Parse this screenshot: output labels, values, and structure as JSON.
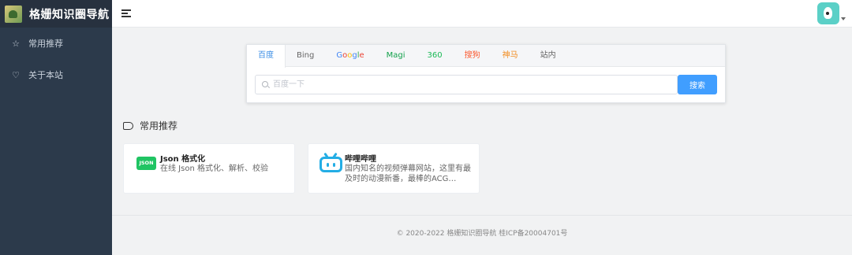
{
  "brand": {
    "title": "格姗知识圈导航"
  },
  "sidebar": {
    "items": [
      {
        "label": "常用推荐",
        "icon": "star-icon"
      },
      {
        "label": "关于本站",
        "icon": "heart-icon"
      }
    ]
  },
  "search": {
    "tabs": [
      "百度",
      "Bing",
      "Google",
      "Magi",
      "360",
      "搜狗",
      "神马",
      "站内"
    ],
    "active_tab": "百度",
    "placeholder": "百度一下",
    "button_label": "搜索"
  },
  "section": {
    "title": "常用推荐"
  },
  "cards": [
    {
      "title": "Json 格式化",
      "desc": "在线 Json 格式化、解析、校验",
      "icon": "JSON"
    },
    {
      "title": "哔哩哔哩",
      "desc": "国内知名的视频弹幕网站，这里有最及时的动漫新番，最棒的ACG…"
    }
  ],
  "footer": {
    "text": "© 2020-2022 格姗知识圈导航 桂ICP备20004701号"
  },
  "colors": {
    "accent": "#409eff",
    "sidebar_bg": "#2c3a4b",
    "json_badge": "#20c463",
    "bilibili": "#23ade5"
  }
}
